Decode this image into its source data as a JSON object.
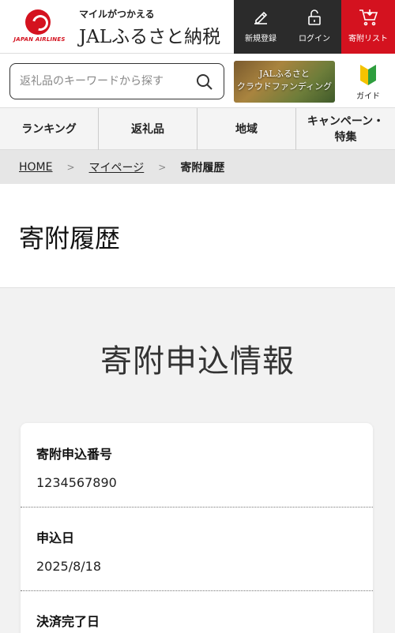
{
  "header": {
    "logo_text": "JAPAN AIRLINES",
    "tagline": "マイルがつかえる",
    "brand": "JALふるさと納税",
    "buttons": {
      "register": "新規登録",
      "login": "ログイン",
      "wishlist": "寄附リスト"
    },
    "colors": {
      "dark": "#2b2b2b",
      "accent": "#d4121f"
    }
  },
  "search": {
    "placeholder": "返礼品のキーワードから探す",
    "value": ""
  },
  "banner": {
    "line1": "JALふるさと",
    "line2": "クラウドファンディング"
  },
  "guide": {
    "label": "ガイド",
    "icon": "beginner-mark-icon"
  },
  "nav": {
    "ranking": "ランキング",
    "gifts": "返礼品",
    "region": "地域",
    "campaign_line1": "キャンペーン・",
    "campaign_line2": "特集"
  },
  "breadcrumb": {
    "home": "HOME",
    "mypage": "マイページ",
    "current": "寄附履歴"
  },
  "page_title": "寄附履歴",
  "section_title": "寄附申込情報",
  "card": {
    "fields": [
      {
        "label": "寄附申込番号",
        "value": "1234567890"
      },
      {
        "label": "申込日",
        "value": "2025/8/18"
      },
      {
        "label": "決済完了日",
        "value": ""
      }
    ]
  }
}
